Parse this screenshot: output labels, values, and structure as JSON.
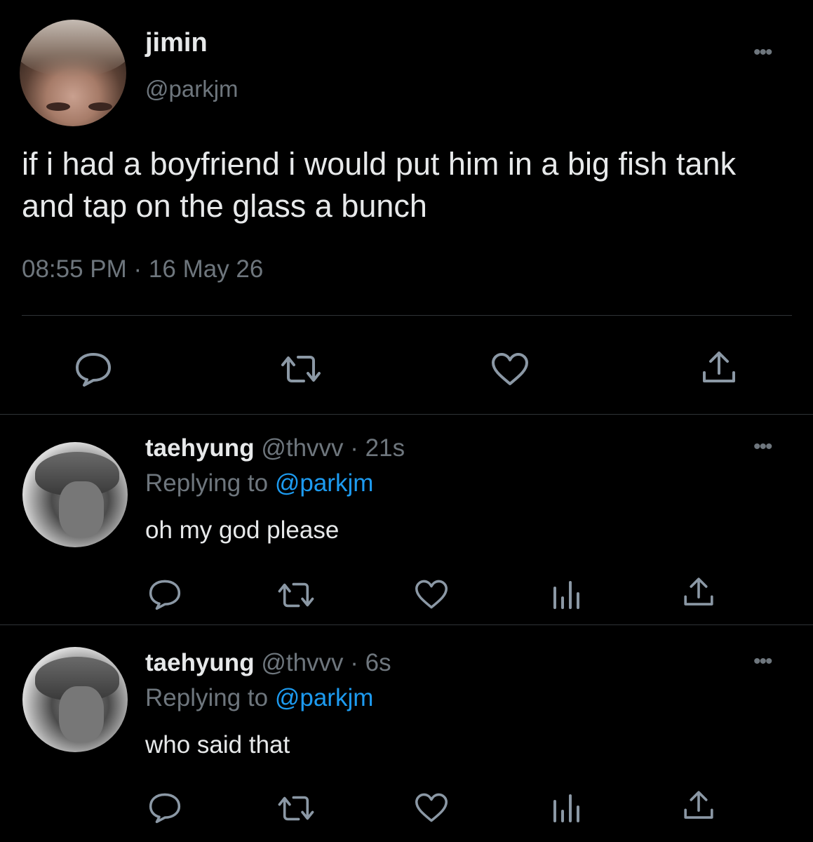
{
  "main_tweet": {
    "display_name": "jimin",
    "handle": "@parkjm",
    "text": "if i had a boyfriend i would put him in a big fish tank and tap on the glass a bunch",
    "timestamp": "08:55 PM · 16 May 26",
    "more_icon": "•••",
    "actions": [
      "reply-icon",
      "retweet-icon",
      "like-icon",
      "share-icon"
    ]
  },
  "replies": [
    {
      "display_name": "taehyung",
      "handle_time": "@thvvv · 21s",
      "replying_prefix": "Replying to ",
      "replying_mention": "@parkjm",
      "text": "oh my god please",
      "more_icon": "•••",
      "actions": [
        "reply-icon",
        "retweet-icon",
        "like-icon",
        "analytics-icon",
        "share-icon"
      ]
    },
    {
      "display_name": "taehyung",
      "handle_time": "@thvvv · 6s",
      "replying_prefix": "Replying to ",
      "replying_mention": "@parkjm",
      "text": "who said that",
      "more_icon": "•••",
      "actions": [
        "reply-icon",
        "retweet-icon",
        "like-icon",
        "analytics-icon",
        "share-icon"
      ]
    }
  ],
  "colors": {
    "background": "#000000",
    "primary_text": "#e7e9ea",
    "secondary_text": "#6e767d",
    "mention": "#1d9bf0",
    "divider": "#2f3336",
    "icon": "#8b98a5"
  }
}
